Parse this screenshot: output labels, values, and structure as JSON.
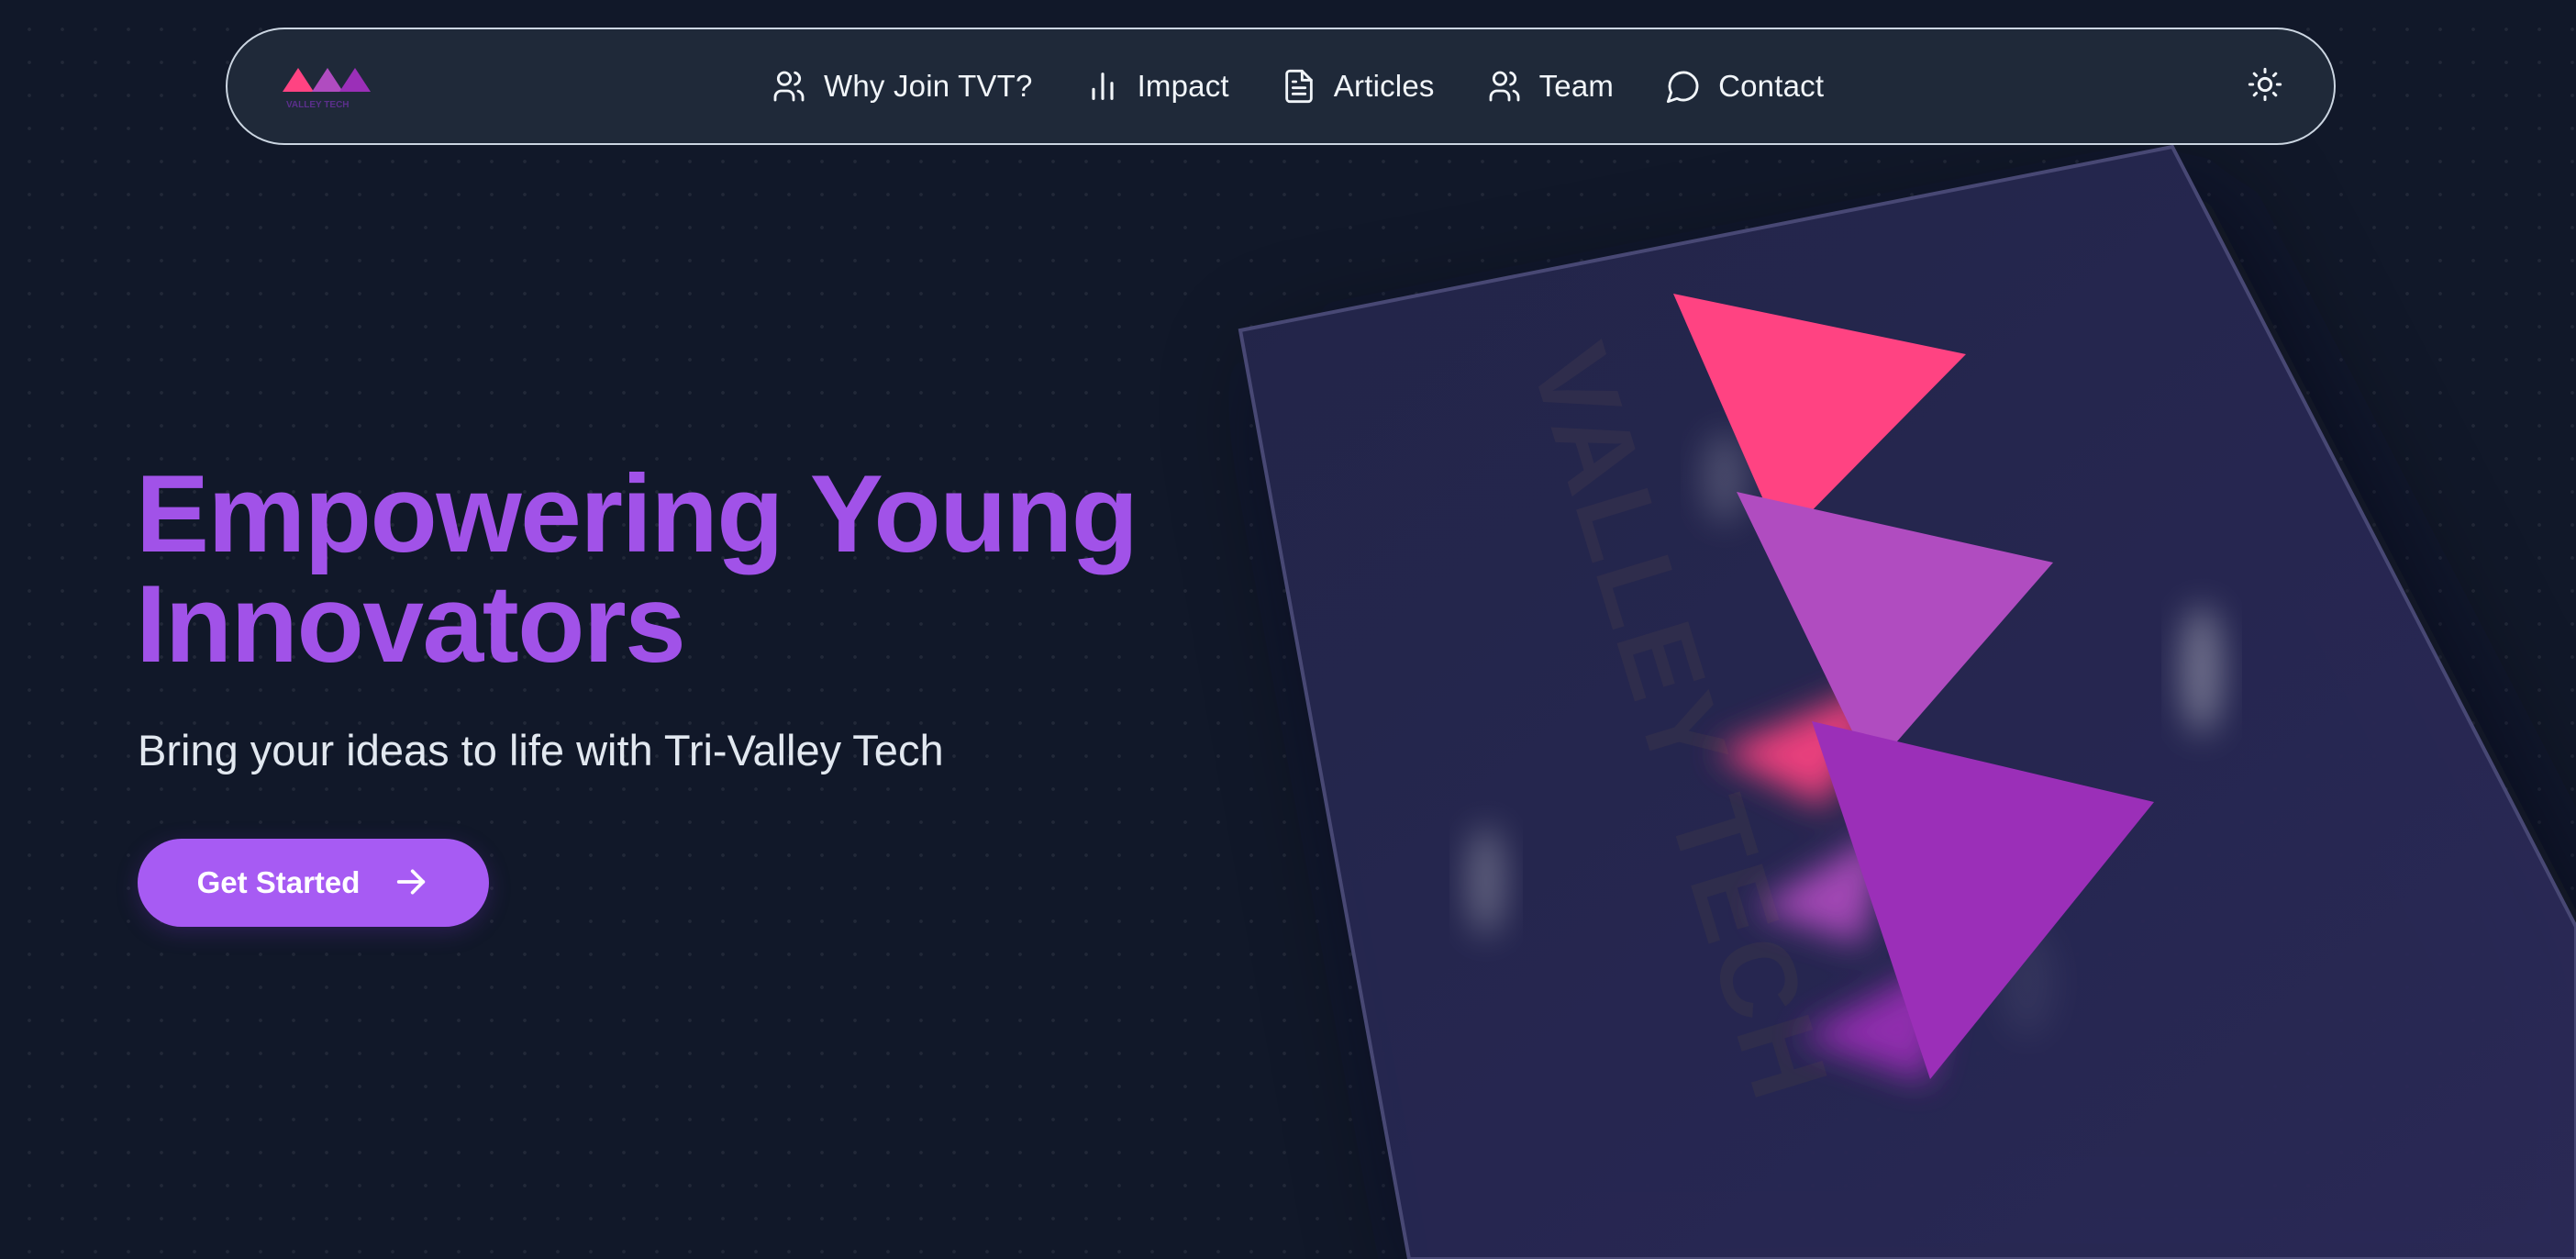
{
  "brand": {
    "logo_text": "VALLEY TECH",
    "colors": {
      "pink": "#ff4382",
      "magenta": "#b04cc0",
      "purple": "#9b2fb8",
      "accent": "#a75bf3",
      "background": "#111829"
    }
  },
  "nav": {
    "items": [
      {
        "label": "Why Join TVT?",
        "icon": "users-icon"
      },
      {
        "label": "Impact",
        "icon": "bar-chart-icon"
      },
      {
        "label": "Articles",
        "icon": "document-icon"
      },
      {
        "label": "Team",
        "icon": "users-icon"
      },
      {
        "label": "Contact",
        "icon": "chat-bubble-icon"
      }
    ],
    "theme_toggle_icon": "sun-icon"
  },
  "hero": {
    "title_line1": "Empowering Young",
    "title_line2": "Innovators",
    "subtitle": "Bring your ideas to life with Tri-Valley Tech",
    "cta_label": "Get Started",
    "cta_icon": "arrow-right-icon"
  },
  "art": {
    "card_text": "VALLEY TECH"
  }
}
